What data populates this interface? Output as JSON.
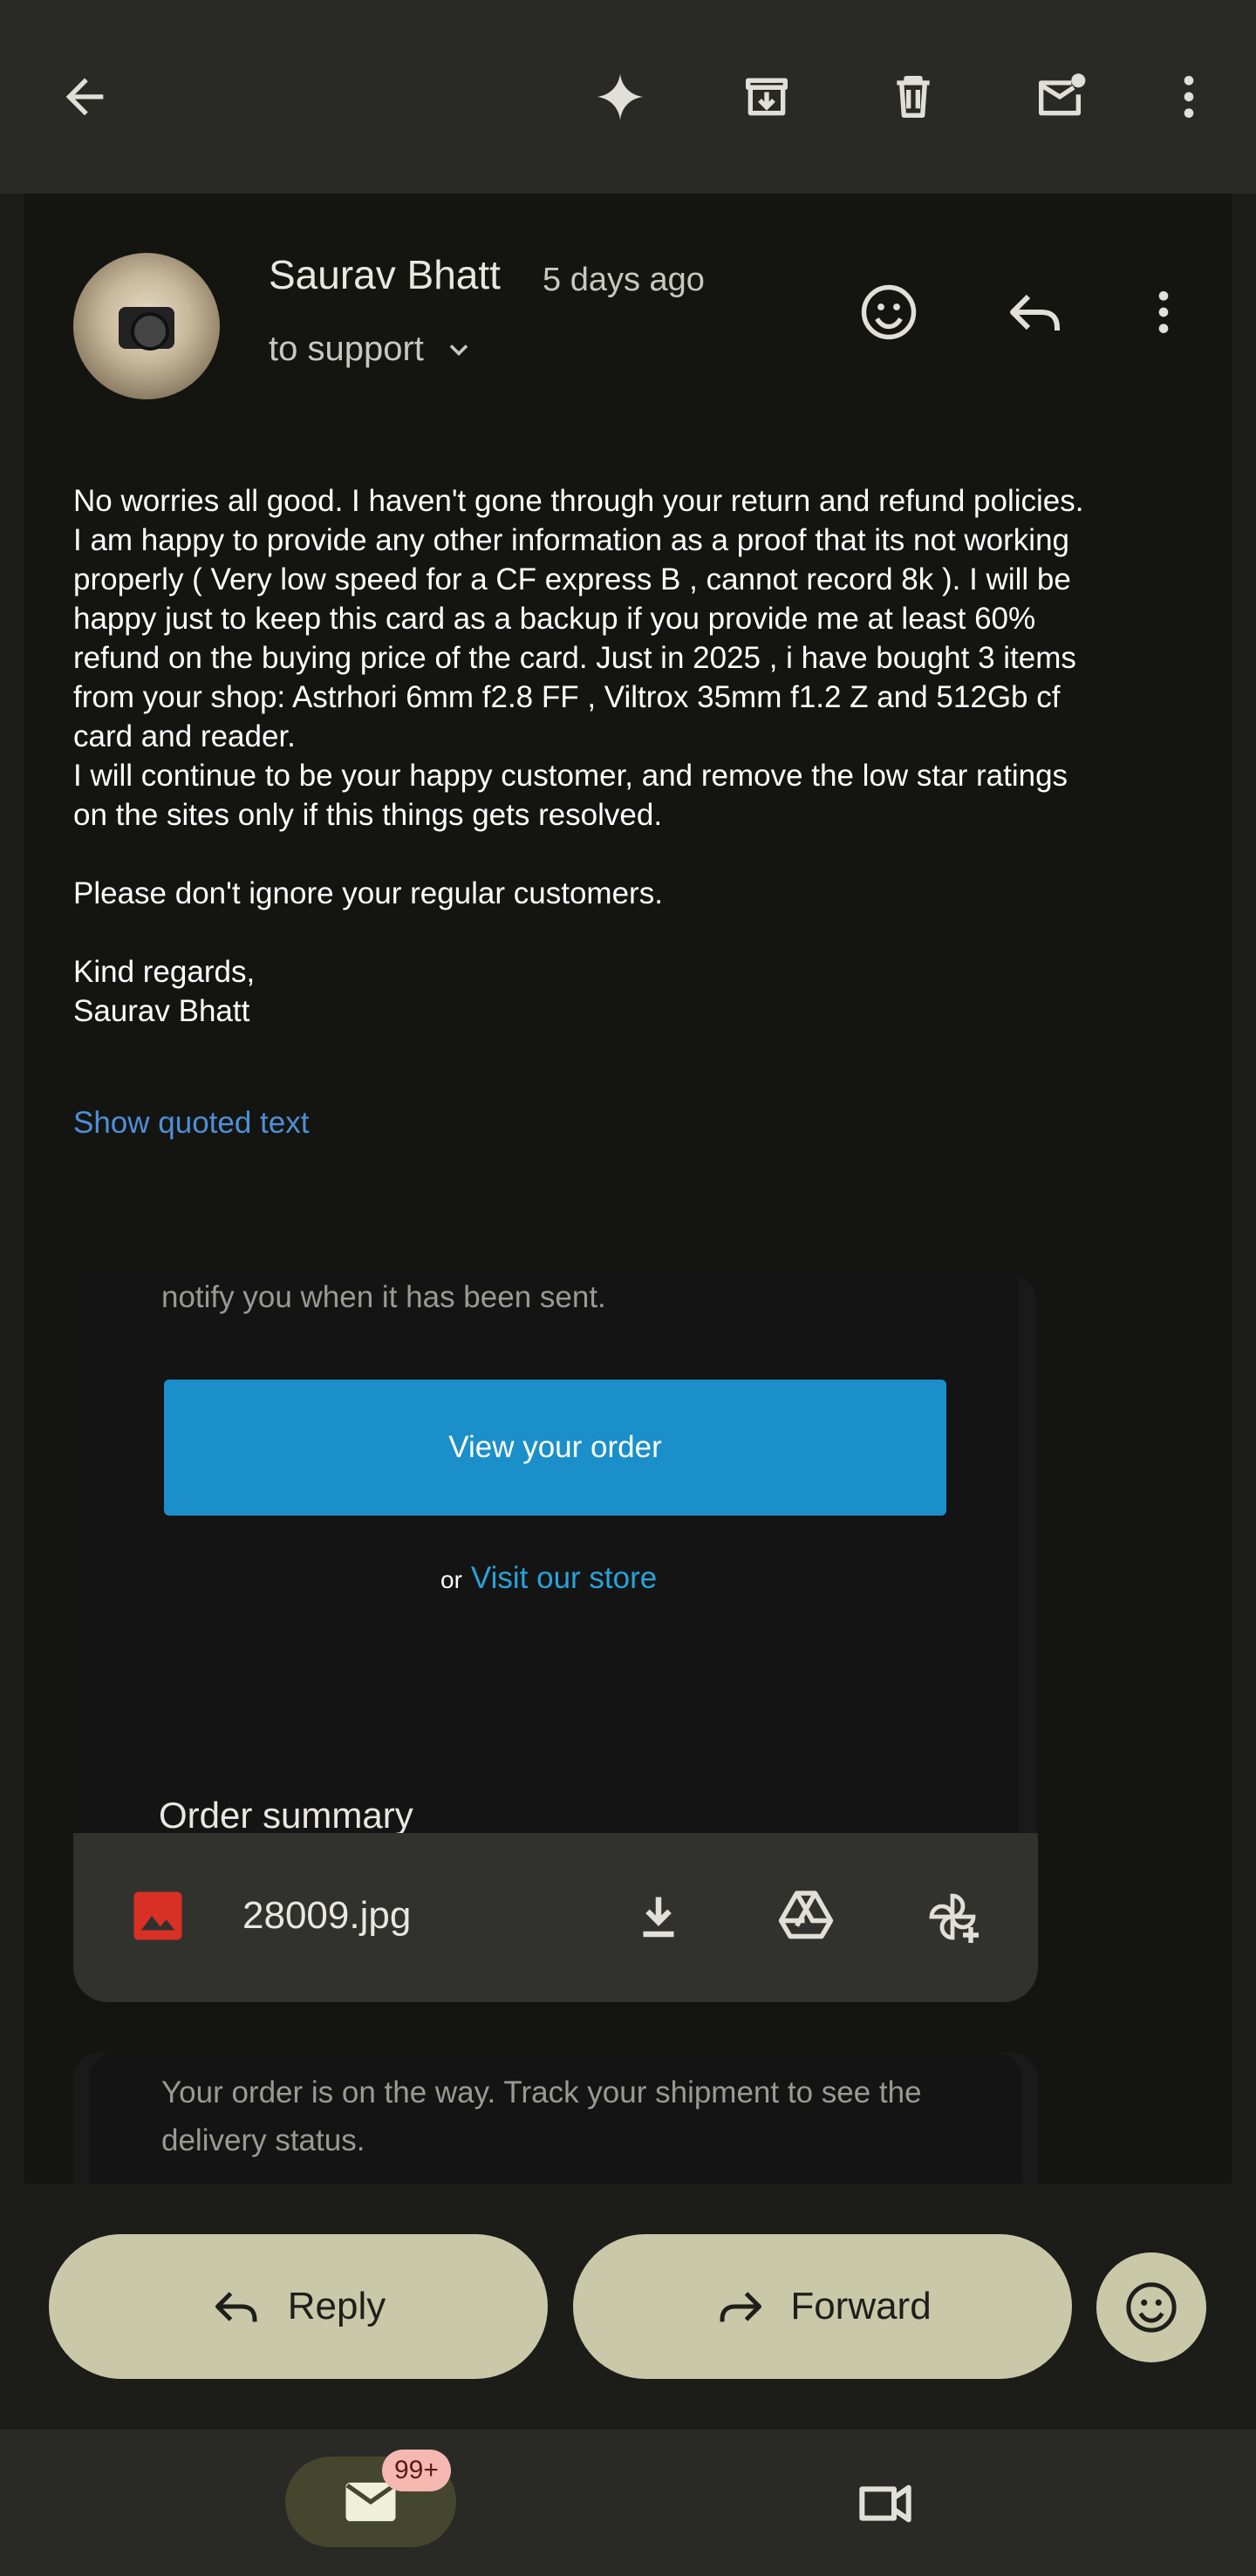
{
  "email": {
    "sender": "Saurav Bhatt",
    "time_ago": "5 days ago",
    "recipient": "to support",
    "body": "No worries all good. I haven't gone through your return and refund policies.\nI am happy to provide any other information as a proof that its not working\nproperly ( Very low speed for a CF express B , cannot record 8k ). I will be\nhappy just to keep this card as a backup if you provide me at least 60%\nrefund on the buying price of the card. Just in 2025 , i have bought 3 items\nfrom your shop: Astrhori 6mm f2.8 FF , Viltrox 35mm f1.2 Z and 512Gb cf\ncard and reader.\nI will continue to be your happy customer, and remove the low star ratings\non the sites only if this things gets resolved.\n\nPlease don't ignore your regular customers.\n\nKind regards,\nSaurav Bhatt",
    "show_quoted": "Show quoted text"
  },
  "quoted_card": {
    "notify_text": "notify you when it has been sent.",
    "view_order": "View your order",
    "or": "or",
    "visit_store": "Visit our store",
    "order_summary": "Order summary"
  },
  "attachment": {
    "filename": "28009.jpg"
  },
  "shipment_card": {
    "text": "Your order is on the way. Track your shipment to see the delivery status."
  },
  "actions": {
    "reply": "Reply",
    "forward": "Forward"
  },
  "nav": {
    "mail_badge": "99+"
  },
  "colors": {
    "accent_button": "#1a8fca",
    "link": "#4f8fd8",
    "pill": "#c9c9a9",
    "attachment_icon": "#d93025",
    "badge_bg": "#f5b8b0"
  },
  "icons": {
    "top": [
      "back-arrow-icon",
      "gemini-sparkle-icon",
      "archive-icon",
      "delete-icon",
      "mark-unread-icon",
      "more-vert-icon"
    ],
    "header": [
      "add-reaction-icon",
      "reply-icon",
      "more-vert-icon"
    ],
    "attachment": [
      "image-file-icon",
      "download-icon",
      "drive-icon",
      "photos-add-icon"
    ],
    "nav": [
      "mail-icon",
      "meet-video-icon"
    ]
  }
}
